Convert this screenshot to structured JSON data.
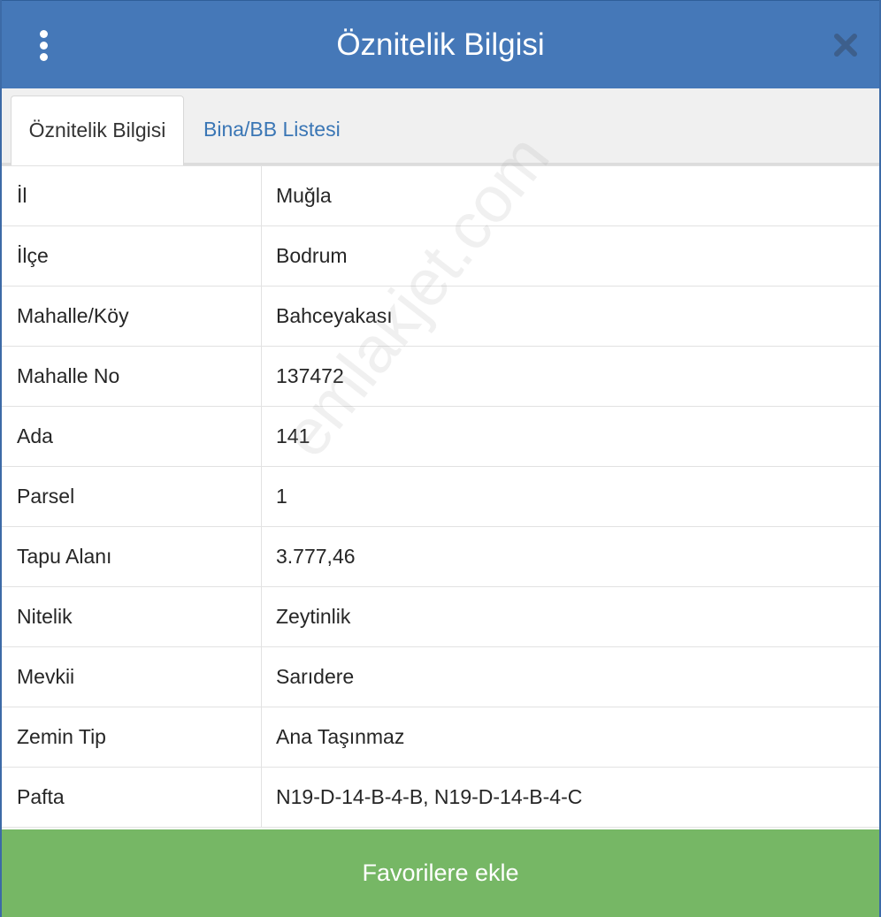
{
  "header": {
    "title": "Öznitelik Bilgisi",
    "menu_icon": "kebab-menu-icon",
    "close_icon": "close-icon"
  },
  "tabs": [
    {
      "label": "Öznitelik Bilgisi",
      "active": true
    },
    {
      "label": "Bina/BB Listesi",
      "active": false
    }
  ],
  "rows": [
    {
      "key": "İl",
      "value": "Muğla"
    },
    {
      "key": "İlçe",
      "value": "Bodrum"
    },
    {
      "key": "Mahalle/Köy",
      "value": "Bahceyakası"
    },
    {
      "key": "Mahalle No",
      "value": "137472"
    },
    {
      "key": "Ada",
      "value": "141"
    },
    {
      "key": "Parsel",
      "value": "1"
    },
    {
      "key": "Tapu Alanı",
      "value": "3.777,46"
    },
    {
      "key": "Nitelik",
      "value": "Zeytinlik"
    },
    {
      "key": "Mevkii",
      "value": "Sarıdere"
    },
    {
      "key": "Zemin Tip",
      "value": "Ana Taşınmaz"
    },
    {
      "key": "Pafta",
      "value": "N19-D-14-B-4-B, N19-D-14-B-4-C"
    }
  ],
  "watermark": "emlakjet.com",
  "footer": {
    "favorite_label": "Favorilere ekle"
  },
  "colors": {
    "header_bg": "#4578b8",
    "button_bg": "#76b765",
    "tab_link": "#3a76b5"
  }
}
